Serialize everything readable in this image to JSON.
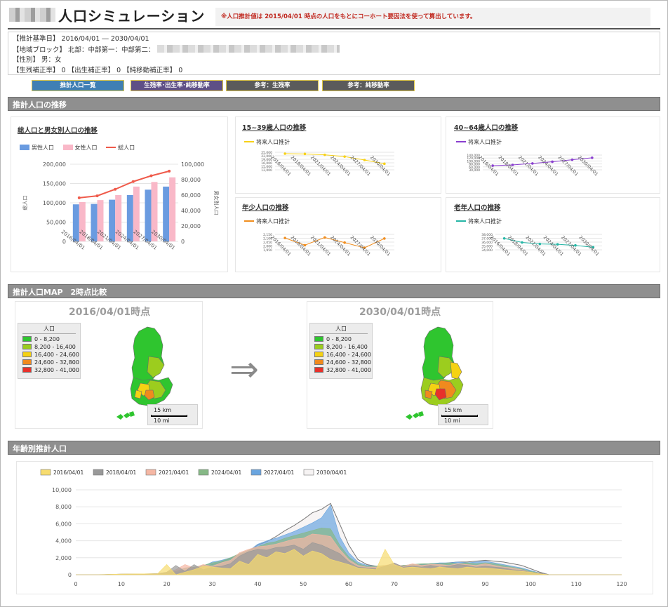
{
  "header": {
    "title": "人口シミュレーション",
    "notice": "※人口推計値は 2015/04/01 時点の人口をもとにコーホート要因法を使って算出しています。"
  },
  "info": {
    "base_period": "【推計基準日】 2016/04/01 ― 2030/04/01",
    "region": "【地域ブロック】 北部：中部第一：中部第二：",
    "sex": "【性別】 男：女",
    "rates": "【生残補正率】 0 【出生補正率】 0 【純移動補正率】 0"
  },
  "tabs": [
    {
      "label": "推計人口一覧",
      "color": "#3f7fb4"
    },
    {
      "label": "生残率･出生率･純移動率",
      "color": "#5e4f86"
    },
    {
      "label": "参考：生残率",
      "color": "#5b5b5b"
    },
    {
      "label": "参考：純移動率",
      "color": "#5b5b5b"
    }
  ],
  "sections": {
    "trend": "推計人口の推移",
    "map": "推計人口MAP　2時点比較",
    "age": "年齢別推計人口"
  },
  "colors": {
    "male": "#6a9be0",
    "female": "#f9b8c8",
    "total": "#ef5a4a",
    "young": "#f7d117",
    "mid": "#8a3fcf",
    "child": "#f08d1e",
    "elderly": "#26b6a6"
  },
  "chart_data": [
    {
      "type": "bar",
      "title": "総人口と男女別人口の推移",
      "categories": [
        "2016/04/01",
        "2018/04/01",
        "2021/04/01",
        "2024/04/01",
        "2027/04/01",
        "2030/04/01"
      ],
      "series": [
        {
          "name": "男性人口",
          "axis": "right",
          "values": [
            48000,
            48500,
            54000,
            60000,
            67000,
            71000
          ]
        },
        {
          "name": "女性人口",
          "axis": "right",
          "values": [
            51000,
            53500,
            60000,
            71000,
            77000,
            83000
          ]
        },
        {
          "name": "総人口",
          "axis": "left",
          "values": [
            113000,
            118000,
            135000,
            155000,
            170000,
            182000
          ]
        }
      ],
      "ylabel": "総人口",
      "y2label": "男女別人口",
      "ylim": [
        0,
        200000
      ],
      "y2lim": [
        0,
        100000
      ],
      "yticks": [
        "200,000",
        "150,000",
        "100,000",
        "50,000",
        "0"
      ],
      "y2ticks": [
        "100,000",
        "80,000",
        "60,000",
        "40,000",
        "20,000",
        "0"
      ]
    },
    {
      "type": "line",
      "title": "15~39歳人口の推移",
      "categories": [
        "2016/04/01",
        "2018/04/01",
        "2021/04/01",
        "2024/04/01",
        "2027/04/01",
        "2030/04/01"
      ],
      "series": [
        {
          "name": "将来人口推計",
          "values": [
            25800,
            25600,
            24800,
            23300,
            20400,
            17200
          ]
        }
      ],
      "ylim": [
        12000,
        27000
      ],
      "yticks": [
        "25,000",
        "22,000",
        "19,000",
        "16,000",
        "15,000",
        "12,000"
      ]
    },
    {
      "type": "line",
      "title": "40~64歳人口の推移",
      "categories": [
        "2016/04/01",
        "2018/04/01",
        "2021/04/01",
        "2024/04/01",
        "2027/04/01",
        "2030/04/01"
      ],
      "series": [
        {
          "name": "将来人口推計",
          "values": [
            64000,
            70000,
            82000,
            96000,
            112000,
            128000
          ]
        }
      ],
      "ylim": [
        30000,
        150000
      ],
      "yticks": [
        "140,000",
        "120,000",
        "100,000",
        "80,000",
        "60,000",
        "30,000"
      ]
    },
    {
      "type": "line",
      "title": "年少人口の推移",
      "categories": [
        "2016/04/01",
        "2018/04/01",
        "2021/04/01",
        "2024/04/01",
        "2027/04/01",
        "2030/04/01"
      ],
      "series": [
        {
          "name": "将来人口推計",
          "values": [
            2130,
            1990,
            2140,
            2040,
            1940,
            2120
          ]
        }
      ],
      "ylim": [
        1900,
        2200
      ],
      "yticks": [
        "2,150",
        "2,100",
        "2,050",
        "2,000",
        "1,950"
      ]
    },
    {
      "type": "line",
      "title": "老年人口の推移",
      "categories": [
        "2016/04/01",
        "2018/04/01",
        "2021/04/01",
        "2024/04/01",
        "2027/04/01",
        "2030/04/01"
      ],
      "series": [
        {
          "name": "将来人口推計",
          "values": [
            36900,
            35800,
            35400,
            35300,
            35000,
            34500
          ]
        }
      ],
      "ylim": [
        33800,
        38000
      ],
      "yticks": [
        "38,000",
        "37,000",
        "36,000",
        "35,000",
        "34,000"
      ]
    },
    {
      "type": "area",
      "title": "年齢別推計人口",
      "xlim": [
        0,
        120
      ],
      "ylim": [
        0,
        10000
      ],
      "xticks": [
        "0",
        "10",
        "20",
        "30",
        "40",
        "50",
        "60",
        "70",
        "80",
        "90",
        "100",
        "110",
        "120"
      ],
      "yticks": [
        "10,000",
        "8,000",
        "6,000",
        "4,000",
        "2,000",
        "0"
      ],
      "x": [
        0,
        5,
        10,
        15,
        18,
        20,
        22,
        24,
        26,
        28,
        30,
        32,
        34,
        36,
        38,
        40,
        42,
        44,
        46,
        48,
        50,
        52,
        54,
        56,
        58,
        60,
        62,
        64,
        66,
        68,
        70,
        72,
        74,
        76,
        78,
        80,
        82,
        84,
        86,
        88,
        90,
        92,
        94,
        96,
        98,
        100,
        102,
        104,
        106,
        108,
        110,
        120
      ],
      "series": [
        {
          "name": "2016/04/01",
          "color": "#f7dc6f",
          "values": [
            0,
            0,
            80,
            100,
            120,
            1200,
            0,
            300,
            600,
            1000,
            900,
            800,
            700,
            1600,
            1200,
            2400,
            2000,
            2700,
            2500,
            3000,
            2200,
            2800,
            2500,
            1800,
            1500,
            1200,
            800,
            700,
            600,
            3000,
            1200,
            800,
            900,
            800,
            700,
            900,
            800,
            700,
            900,
            800,
            800,
            700,
            600,
            500,
            400,
            300,
            100,
            0,
            0,
            0,
            0,
            0
          ]
        },
        {
          "name": "2018/04/01",
          "color": "#999999",
          "values": [
            0,
            0,
            80,
            100,
            140,
            300,
            1100,
            400,
            1200,
            600,
            900,
            1000,
            1300,
            2200,
            2700,
            3000,
            2900,
            3200,
            3300,
            3500,
            3000,
            3800,
            3500,
            3000,
            2500,
            1500,
            900,
            800,
            700,
            1000,
            1400,
            900,
            1000,
            900,
            1100,
            900,
            1000,
            1200,
            1100,
            900,
            1000,
            900,
            800,
            600,
            500,
            300,
            200,
            0,
            0,
            0,
            0,
            0
          ]
        },
        {
          "name": "2021/04/01",
          "color": "#f5b7a4",
          "values": [
            0,
            0,
            60,
            90,
            120,
            300,
            600,
            1200,
            800,
            1200,
            1000,
            1400,
            1700,
            2600,
            3000,
            3300,
            3400,
            3600,
            3900,
            4200,
            4300,
            4800,
            4700,
            4500,
            3000,
            1800,
            1100,
            900,
            900,
            1100,
            1300,
            1000,
            1300,
            1100,
            1200,
            1200,
            1100,
            1300,
            1200,
            1100,
            1300,
            1100,
            900,
            800,
            600,
            300,
            200,
            0,
            0,
            0,
            0,
            0
          ]
        },
        {
          "name": "2024/04/01",
          "color": "#86b886",
          "values": [
            0,
            0,
            60,
            80,
            110,
            200,
            400,
            800,
            900,
            1100,
            1400,
            1600,
            2000,
            2500,
            2900,
            3300,
            3700,
            3900,
            4300,
            4600,
            4900,
            5200,
            5500,
            5400,
            3500,
            2100,
            1300,
            1000,
            1000,
            1100,
            1000,
            1100,
            1200,
            1300,
            1300,
            1300,
            1400,
            1300,
            1400,
            1300,
            1400,
            1300,
            1100,
            900,
            700,
            400,
            200,
            0,
            0,
            0,
            0,
            0
          ]
        },
        {
          "name": "2027/04/01",
          "color": "#6aa5df",
          "values": [
            0,
            0,
            60,
            80,
            100,
            200,
            300,
            500,
            800,
            1000,
            1500,
            1700,
            2000,
            2400,
            2800,
            3600,
            4000,
            4300,
            4700,
            5100,
            5600,
            6100,
            6700,
            8200,
            4500,
            2600,
            1500,
            1100,
            1000,
            1000,
            1000,
            1100,
            1100,
            1200,
            1300,
            1400,
            1400,
            1500,
            1400,
            1500,
            1600,
            1400,
            1200,
            1000,
            800,
            500,
            200,
            0,
            0,
            0,
            0,
            0
          ]
        },
        {
          "name": "2030/04/01",
          "color": "#f6f3f3",
          "values": [
            0,
            0,
            50,
            70,
            90,
            150,
            250,
            400,
            700,
            900,
            1200,
            1500,
            1900,
            2300,
            2700,
            3500,
            3900,
            4500,
            5200,
            5800,
            6500,
            7300,
            7700,
            8400,
            6000,
            3500,
            1800,
            1200,
            1000,
            1000,
            1000,
            1100,
            1100,
            1200,
            1300,
            1300,
            1400,
            1500,
            1500,
            1600,
            1700,
            1600,
            1500,
            1300,
            1100,
            700,
            300,
            0,
            0,
            0,
            0,
            0
          ]
        }
      ]
    }
  ],
  "map": {
    "left": {
      "date": "2016/04/01時点"
    },
    "right": {
      "date": "2030/04/01時点"
    },
    "legend_title": "人口",
    "legend": [
      {
        "label": "0 - 8,200",
        "color": "#2fc52f"
      },
      {
        "label": "8,200 - 16,400",
        "color": "#9ccd1e"
      },
      {
        "label": "16,400 - 24,600",
        "color": "#f5d213"
      },
      {
        "label": "24,600 - 32,800",
        "color": "#f08a1e"
      },
      {
        "label": "32,800 - 41,000",
        "color": "#e8302a"
      }
    ],
    "scale_km": "15 km",
    "scale_mi": "10 mi"
  }
}
